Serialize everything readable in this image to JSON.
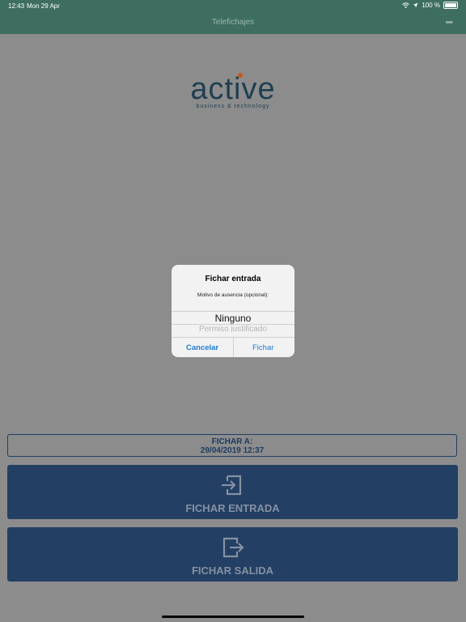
{
  "status_bar": {
    "time": "12:43",
    "date": "Mon 29 Apr",
    "battery": "100 %"
  },
  "navbar": {
    "title": "Telefichajes",
    "more_icon": "ellipsis-icon"
  },
  "logo": {
    "word": "active",
    "tagline": "business & technology",
    "colors": {
      "text": "#1f3e52",
      "dot": "#c25a1b"
    }
  },
  "fichar_a": {
    "label": "FICHAR A:",
    "datetime": "29/04/2019 12:37"
  },
  "buttons": {
    "entrada": {
      "label": "FICHAR ENTRADA",
      "icon": "sign-in-icon"
    },
    "salida": {
      "label": "FICHAR SALIDA",
      "icon": "sign-out-icon"
    }
  },
  "dialog": {
    "title": "Fichar entrada",
    "subtitle": "Motivo de ausencia (opcional):",
    "picker": {
      "selected": "Ninguno",
      "next": "Permiso justificado"
    },
    "cancel_label": "Cancelar",
    "confirm_label": "Fichar"
  },
  "colors": {
    "header": "#3d6e5f",
    "button": "#233f63",
    "dialog_action": "#1c7bd6"
  }
}
